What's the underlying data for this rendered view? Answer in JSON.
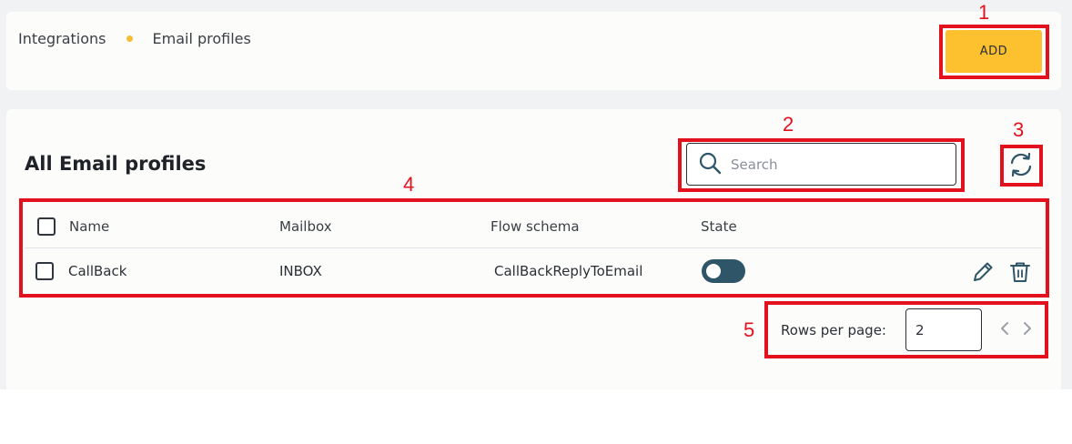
{
  "breadcrumb": {
    "items": [
      "Integrations",
      "Email profiles"
    ]
  },
  "add_button": {
    "label": "ADD"
  },
  "page_title": "All Email profiles",
  "search": {
    "placeholder": "Search",
    "value": ""
  },
  "table": {
    "columns": [
      "Name",
      "Mailbox",
      "Flow schema",
      "State"
    ],
    "rows": [
      {
        "name": "CallBack",
        "mailbox": "INBOX",
        "flow_schema": "CallBackReplyToEmail",
        "state": "off"
      }
    ]
  },
  "pagination": {
    "rows_per_page_label": "Rows per page:",
    "rows_per_page_value": "2"
  },
  "callouts": [
    "1",
    "2",
    "3",
    "4",
    "5"
  ],
  "icons": {
    "search": "search-icon",
    "refresh": "refresh-icon",
    "edit": "pencil-icon",
    "delete": "trash-icon",
    "prev": "chevron-left-icon",
    "next": "chevron-right-icon"
  },
  "colors": {
    "accent": "#fdc02f",
    "annotation": "#e3111d",
    "toggle": "#2f5569",
    "dot": "#f7be32"
  }
}
